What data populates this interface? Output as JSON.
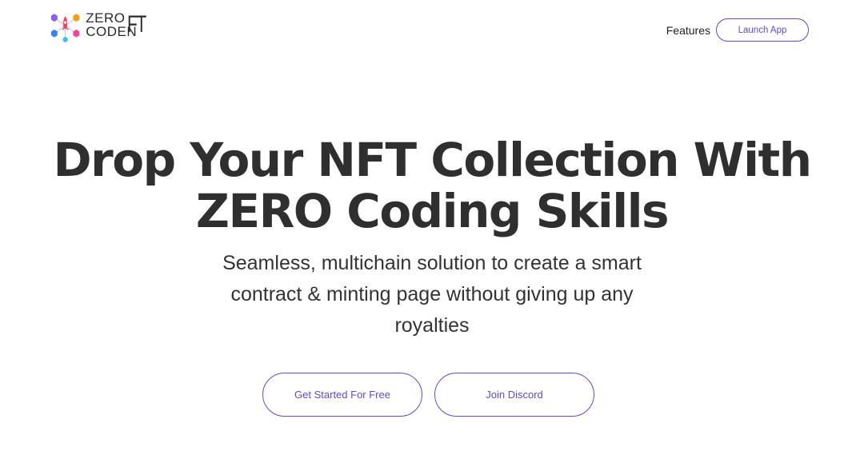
{
  "brand": {
    "logo_line1": "ZERO",
    "logo_line2": "CODEN",
    "logo_ft": "FT",
    "logo_icon": "rocket-cubes-icon"
  },
  "nav": {
    "features_label": "Features",
    "launch_label": "Launch App"
  },
  "hero": {
    "title_line1": "Drop Your NFT Collection With",
    "title_line2": "ZERO Coding Skills",
    "subtitle": "Seamless, multichain solution to create a smart contract & minting page without giving up any royalties"
  },
  "cta": {
    "primary_label": "Get Started For Free",
    "secondary_label": "Join Discord"
  },
  "colors": {
    "accent": "#5b4cdb",
    "text": "#2f2f2f",
    "background": "#ffffff"
  }
}
